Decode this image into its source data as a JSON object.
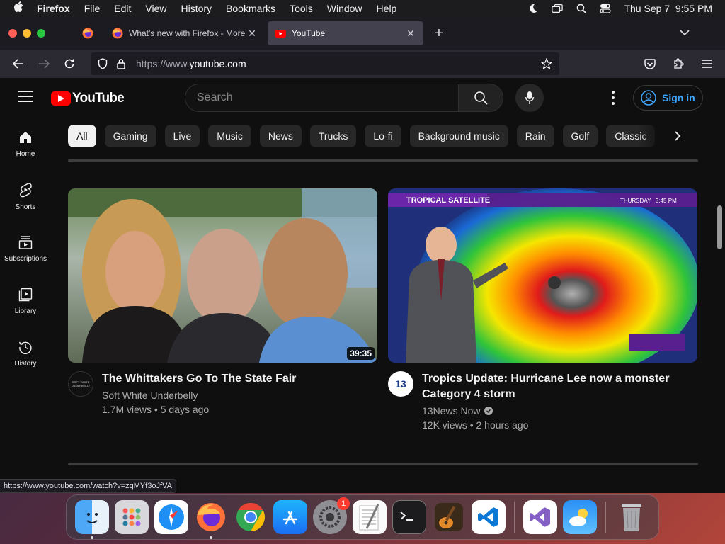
{
  "menubar": {
    "app": "Firefox",
    "items": [
      "File",
      "Edit",
      "View",
      "History",
      "Bookmarks",
      "Tools",
      "Window",
      "Help"
    ],
    "clock": "Thu Sep 7  9:55 PM"
  },
  "tabs": [
    {
      "title": "What's new with Firefox - More",
      "active": false
    },
    {
      "title": "YouTube",
      "active": true
    }
  ],
  "address": {
    "prefix": "https://www.",
    "domain": "youtube.com"
  },
  "youtube": {
    "logo_text": "YouTube",
    "search_placeholder": "Search",
    "sign_in": "Sign in",
    "sidebar": [
      {
        "label": "Home",
        "icon": "home-icon"
      },
      {
        "label": "Shorts",
        "icon": "shorts-icon"
      },
      {
        "label": "Subscriptions",
        "icon": "subscriptions-icon"
      },
      {
        "label": "Library",
        "icon": "library-icon"
      },
      {
        "label": "History",
        "icon": "history-icon"
      }
    ],
    "chips": [
      "All",
      "Gaming",
      "Live",
      "Music",
      "News",
      "Trucks",
      "Lo-fi",
      "Background music",
      "Rain",
      "Golf",
      "Classic"
    ],
    "videos": [
      {
        "title": "The Whittakers Go To The State Fair",
        "channel": "Soft White Underbelly",
        "stats": "1.7M views • 5 days ago",
        "duration": "39:35",
        "avatar_text": "SOFT WHITE UNDERBELLY"
      },
      {
        "title": "Tropics Update: Hurricane Lee now a monster Category 4 storm",
        "channel": "13News Now",
        "stats": "12K views • 2 hours ago",
        "overlay_left": "TROPICAL SATELLITE",
        "overlay_right": "THURSDAY   3:45 PM",
        "avatar_text": "13"
      }
    ]
  },
  "status_url": "https://www.youtube.com/watch?v=zqMYf3oJfVA",
  "dock": {
    "settings_badge": "1"
  },
  "colors": {
    "yt_red": "#ff0000",
    "link_blue": "#3ea6ff",
    "bg": "#0f0f0f"
  }
}
